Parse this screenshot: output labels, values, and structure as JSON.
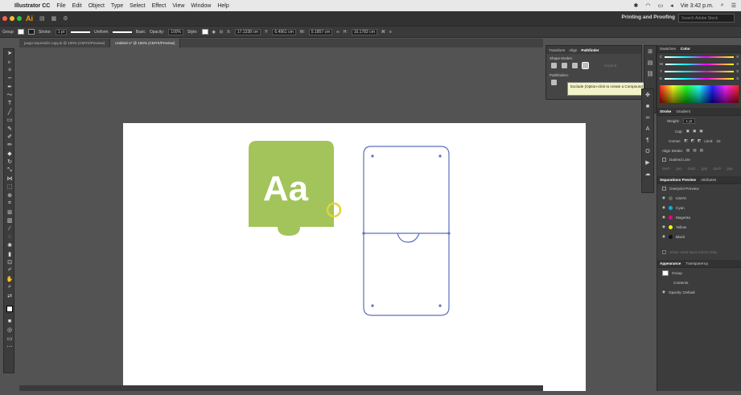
{
  "menubar": {
    "app_name": "Illustrator CC",
    "items": [
      "File",
      "Edit",
      "Object",
      "Type",
      "Select",
      "Effect",
      "View",
      "Window",
      "Help"
    ],
    "clock": "Vie 3:42 p.m."
  },
  "appbar": {
    "logo": "Ai",
    "workspace": "Printing and Proofing",
    "search_placeholder": "Search Adobe Stock"
  },
  "controlbar": {
    "selection": "Group",
    "stroke_label": "Stroke:",
    "stroke_weight": "1 pt",
    "profile": "Uniform",
    "brush": "Basic",
    "opacity_label": "Opacity:",
    "opacity_value": "100%",
    "style_label": "Style:",
    "x_label": "X:",
    "x_value": "17.1338 cm",
    "y_label": "Y:",
    "y_value": "6.4961 cm",
    "w_label": "W:",
    "w_value": "5.1857 cm",
    "h_label": "H:",
    "h_value": "10.1782 cm"
  },
  "doc_tabs": [
    "juego-impresión copy.ai @ 100% (CMYK/Preview)",
    "Untitled-1* @ 150% (CMYK/Preview)"
  ],
  "pathfinder": {
    "tabs": [
      "Transform",
      "Align",
      "Pathfinder"
    ],
    "shape_modes_label": "Shape Modes:",
    "expand_label": "Expand",
    "pathfinders_label": "Pathfinders:"
  },
  "tooltip": "Exclude (Option-click to create a Compound Shape and exclude overlapping shape areas)",
  "color_panel": {
    "tabs": [
      "Swatches",
      "Color"
    ],
    "channels": [
      {
        "label": "C",
        "value": "0"
      },
      {
        "label": "M",
        "value": "0"
      },
      {
        "label": "Y",
        "value": "0"
      },
      {
        "label": "K",
        "value": "0"
      }
    ]
  },
  "stroke_panel": {
    "tabs": [
      "Stroke",
      "Gradient"
    ],
    "weight_label": "Weight:",
    "weight_value": "1 pt",
    "cap_label": "Cap:",
    "corner_label": "Corner:",
    "limit_label": "Limit:",
    "limit_value": "10",
    "align_label": "Align Stroke:",
    "dashed_label": "Dashed Line",
    "dash_fields": [
      "dash",
      "gap",
      "dash",
      "gap",
      "dash",
      "gap"
    ]
  },
  "separations_panel": {
    "tabs": [
      "Separations Preview",
      "Attributes"
    ],
    "overprint_label": "Overprint Preview",
    "plates": [
      {
        "name": "CMYK",
        "color": "#666666"
      },
      {
        "name": "Cyan",
        "color": "#00aeef"
      },
      {
        "name": "Magenta",
        "color": "#ec008c"
      },
      {
        "name": "Yellow",
        "color": "#fff200"
      },
      {
        "name": "Black",
        "color": "#111111"
      }
    ],
    "spot_label": "Show Used Spot Colors Only"
  },
  "appearance_panel": {
    "tabs": [
      "Appearance",
      "Transparency"
    ],
    "group_label": "Group",
    "contents_label": "Contents",
    "opacity_row": "Opacity: Default"
  },
  "artwork": {
    "logo_text": "Aa",
    "logo_color": "#a2c45a",
    "outline_color": "#5b6fc0",
    "ring_color": "#e3d33b"
  }
}
